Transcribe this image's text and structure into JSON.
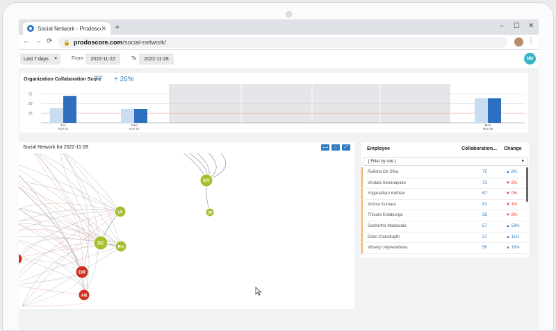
{
  "browser": {
    "tab_title": "Social Network - Prodoscore",
    "tab_close": "✕",
    "new_tab": "+",
    "url_domain": "prodoscore.com",
    "url_path": "/social-network/",
    "window_controls": [
      "–",
      "☐",
      "✕"
    ],
    "nav": [
      "←",
      "→",
      "⟳"
    ]
  },
  "toolbar": {
    "range_label": "Last 7 days",
    "from_label": "From",
    "from_value": "2022-11-22",
    "to_label": "To",
    "to_value": "2022-11-28",
    "user_initials": "NM"
  },
  "score_card": {
    "title": "Organization Collaboration Score",
    "score": "77",
    "delta": "+ 26%"
  },
  "chart_data": {
    "type": "bar",
    "categories": [
      "Tue Nov 22",
      "Wed Nov 23",
      "Mon Nov 28"
    ],
    "yticks": [
      75,
      50,
      25
    ],
    "series": [
      {
        "values": [
          38,
          36,
          64
        ],
        "color": "#c8ddf0"
      },
      {
        "values": [
          70,
          36,
          64
        ],
        "color": "#2f6fc0"
      }
    ]
  },
  "network": {
    "title": "Social Network for 2022-11-28",
    "controls": [
      "⟷",
      "⌂",
      "⤢"
    ],
    "nodes": [
      {
        "id": "NY",
        "color": "#a4bf2f"
      },
      {
        "id": "JF",
        "color": "#a4bf2f"
      },
      {
        "id": "LV",
        "color": "#a4bf2f"
      },
      {
        "id": "DC",
        "color": "#a4bf2f"
      },
      {
        "id": "RA",
        "color": "#a4bf2f"
      },
      {
        "id": "DR",
        "color": "#cc2f1e"
      },
      {
        "id": "AB",
        "color": "#cc2f1e"
      }
    ]
  },
  "employees": {
    "col_employee": "Employee",
    "col_score": "Collaboration...",
    "col_change": "Change",
    "filter_label": "[ Filter by role ]",
    "rows": [
      {
        "name": "Ruksha De Silva",
        "score": "75",
        "change": "8%",
        "dir": "up"
      },
      {
        "name": "Vindula Senanayake",
        "score": "73",
        "change": "6%",
        "dir": "down"
      },
      {
        "name": "Yoganathan Kethlan",
        "score": "67",
        "change": "0%",
        "dir": "down"
      },
      {
        "name": "Vishva Kumara",
        "score": "61",
        "change": "1%",
        "dir": "down"
      },
      {
        "name": "Thisara Kolabunga",
        "score": "58",
        "change": "8%",
        "dir": "down"
      },
      {
        "name": "Sachintha Madawala",
        "score": "57",
        "change": "53%",
        "dir": "up"
      },
      {
        "name": "Dilan Chandrajith",
        "score": "57",
        "change": "11%",
        "dir": "up"
      },
      {
        "name": "Vihangi Jayawardena",
        "score": "56",
        "change": "16%",
        "dir": "up"
      }
    ]
  }
}
